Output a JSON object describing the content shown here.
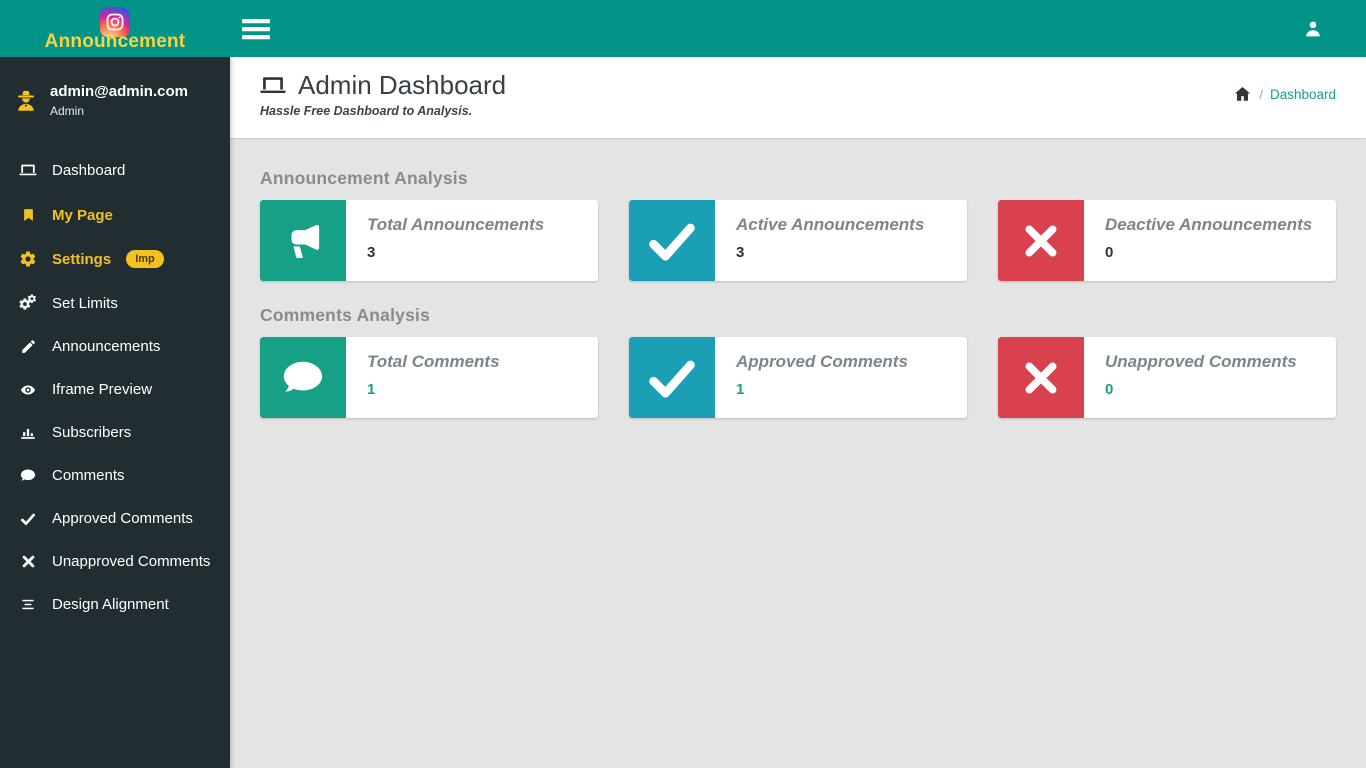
{
  "brand": {
    "name": "Announcement",
    "logo_icon": "instagram-icon"
  },
  "topbar": {
    "menu_icon": "hamburger-icon",
    "account_icon": "user-icon"
  },
  "user_panel": {
    "icon": "user-secret-icon",
    "email": "admin@admin.com",
    "role": "Admin"
  },
  "sidebar": {
    "items": [
      {
        "icon": "laptop-icon",
        "label": "Dashboard",
        "highlight": false
      },
      {
        "icon": "bookmark-icon",
        "label": "My Page",
        "highlight": true
      },
      {
        "icon": "gear-icon",
        "label": "Settings",
        "highlight": true,
        "badge": "Imp"
      },
      {
        "icon": "cogs-icon",
        "label": "Set Limits",
        "highlight": false
      },
      {
        "icon": "pencil-icon",
        "label": "Announcements",
        "highlight": false
      },
      {
        "icon": "eye-icon",
        "label": "Iframe Preview",
        "highlight": false
      },
      {
        "icon": "bar-chart-icon",
        "label": "Subscribers",
        "highlight": false
      },
      {
        "icon": "comment-icon",
        "label": "Comments",
        "highlight": false
      },
      {
        "icon": "check-icon",
        "label": "Approved Comments",
        "highlight": false
      },
      {
        "icon": "x-icon",
        "label": "Unapproved Comments",
        "highlight": false
      },
      {
        "icon": "align-icon",
        "label": "Design Alignment",
        "highlight": false
      }
    ]
  },
  "page_header": {
    "icon": "laptop-icon",
    "title": "Admin Dashboard",
    "subtitle": "Hassle Free Dashboard to Analysis.",
    "breadcrumb": {
      "home_icon": "home-icon",
      "separator": "/",
      "current": "Dashboard"
    }
  },
  "sections": [
    {
      "title": "Announcement Analysis",
      "cards": [
        {
          "icon": "bullhorn-icon",
          "icon_bg": "#16a085",
          "title": "Total Announcements",
          "value": "3",
          "value_color": "#333333"
        },
        {
          "icon": "check-icon",
          "icon_bg": "#1a9fb5",
          "title": "Active Announcements",
          "value": "3",
          "value_color": "#333333"
        },
        {
          "icon": "x-icon",
          "icon_bg": "#d9414e",
          "title": "Deactive Announcements",
          "value": "0",
          "value_color": "#333333"
        }
      ]
    },
    {
      "title": "Comments Analysis",
      "cards": [
        {
          "icon": "comment-icon",
          "icon_bg": "#16a085",
          "title": "Total Comments",
          "value": "1",
          "value_color": "#16a085"
        },
        {
          "icon": "check-icon",
          "icon_bg": "#1a9fb5",
          "title": "Approved Comments",
          "value": "1",
          "value_color": "#16a085"
        },
        {
          "icon": "x-icon",
          "icon_bg": "#d9414e",
          "title": "Unapproved Comments",
          "value": "0",
          "value_color": "#16a085"
        }
      ]
    }
  ],
  "colors": {
    "header_bg": "#029587",
    "sidebar_bg": "#222d32",
    "content_bg": "#e4e4e4",
    "accent_yellow": "#f3c220",
    "logo_yellow": "#f7d344",
    "link_teal": "#16a085"
  }
}
